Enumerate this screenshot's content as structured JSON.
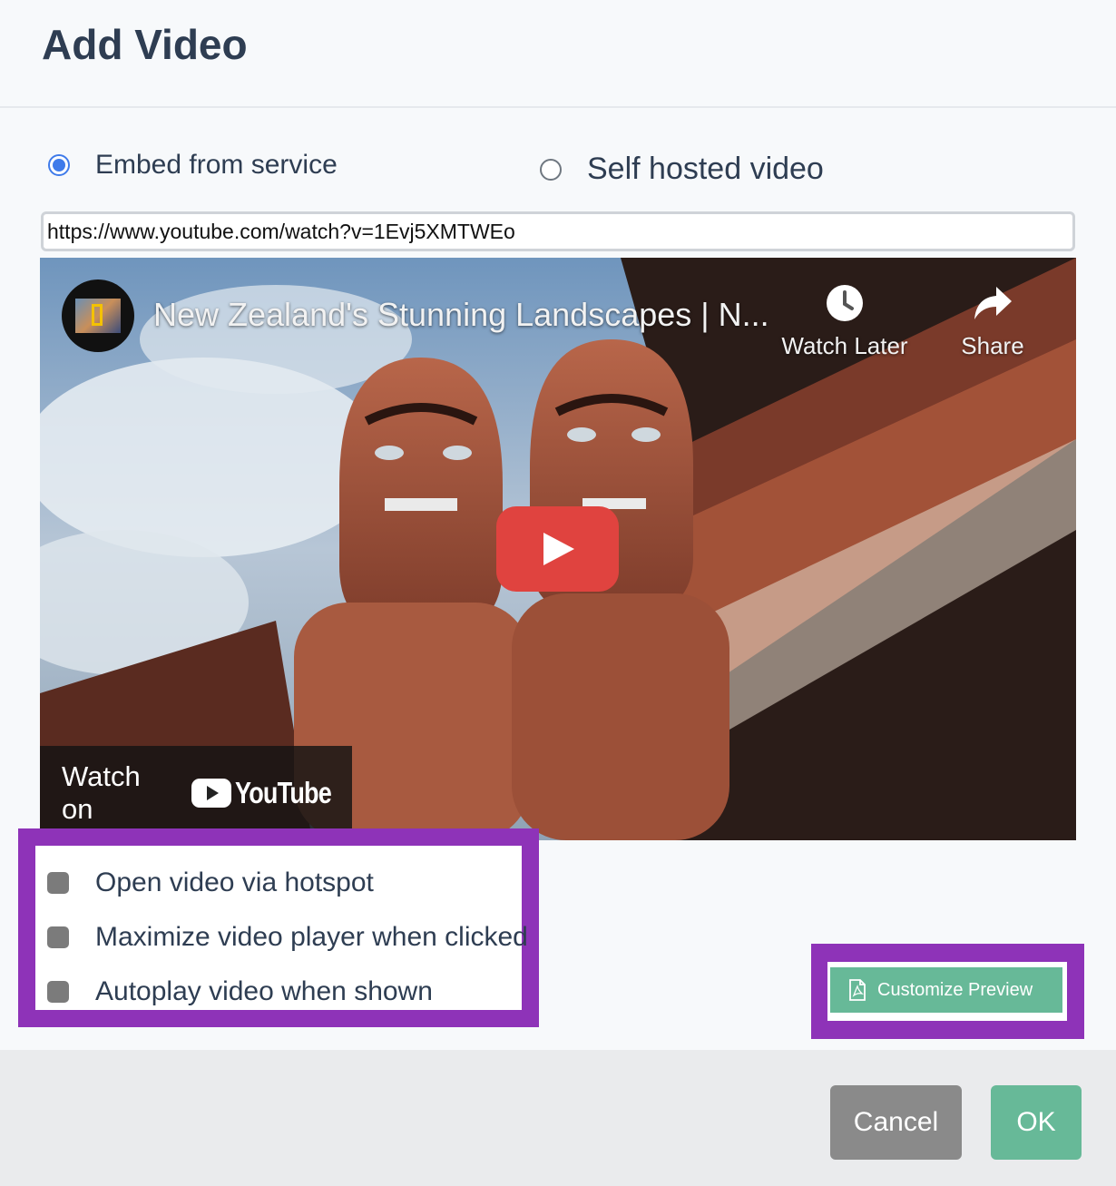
{
  "dialog": {
    "title": "Add Video"
  },
  "source": {
    "embed_label": "Embed from service",
    "self_hosted_label": "Self hosted video",
    "selected": "embed"
  },
  "url_input": {
    "value": "https://www.youtube.com/watch?v=1Evj5XMTWEo"
  },
  "video": {
    "title": "New Zealand's Stunning Landscapes | N...",
    "watch_later_label": "Watch Later",
    "share_label": "Share",
    "watch_on_label": "Watch on",
    "youtube_logo_text": "YouTube",
    "play_button_color": "#e0433f"
  },
  "options": [
    {
      "label": "Open video via hotspot",
      "checked": false
    },
    {
      "label": "Maximize video player when clicked",
      "checked": false
    },
    {
      "label": "Autoplay video when shown",
      "checked": false
    }
  ],
  "customize_preview": {
    "label": "Customize Preview",
    "icon": "pdf-file-icon"
  },
  "footer": {
    "cancel_label": "Cancel",
    "ok_label": "OK"
  },
  "colors": {
    "accent_green": "#67b998",
    "highlight_purple": "#8e33b8",
    "radio_blue": "#3f7bea",
    "title_text": "#2e3d52"
  }
}
